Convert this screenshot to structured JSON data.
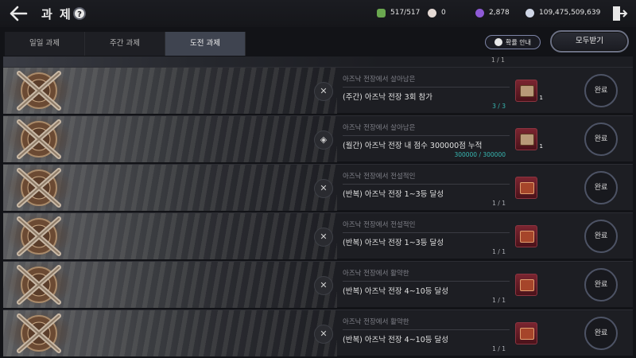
{
  "header": {
    "title": "과 제",
    "help_label": "?",
    "currencies": [
      {
        "icon": "energy-icon",
        "value": "517/517",
        "color": "#6aa84f"
      },
      {
        "icon": "pearl-icon",
        "value": "0",
        "color": "#e4d9d4"
      },
      {
        "icon": "purple-gem-icon",
        "value": "2,878",
        "color": "#8e5ad6"
      },
      {
        "icon": "silver-coin-icon",
        "value": "109,475,509,639",
        "color": "#cfd6e6"
      }
    ]
  },
  "tabs": [
    {
      "label": "일일 과제",
      "active": false
    },
    {
      "label": "주간 과제",
      "active": false
    },
    {
      "label": "도전 과제",
      "active": true
    }
  ],
  "actions": {
    "prob_label": "확률 안내",
    "claim_all_label": "모두받기"
  },
  "partial_row": {
    "progress": "1 / 1"
  },
  "missions": [
    {
      "icon": "cross-icon",
      "icon_glyph": "✕",
      "subtitle": "아즈낙 전장에서 살아남은",
      "title": "(주간) 아즈낙 전장 3회 참가",
      "progress": "3 / 3",
      "progress_teal": true,
      "reward_qty": "1",
      "reward_type": "chest",
      "button": "완료"
    },
    {
      "icon": "diamond-icon",
      "icon_glyph": "◈",
      "subtitle": "아즈낙 전장에서 살아남은",
      "title": "(월간) 아즈낙 전장 내 점수 300000점 누적",
      "progress": "300000 / 300000",
      "progress_teal": true,
      "reward_qty": "1",
      "reward_type": "chest",
      "button": "완료"
    },
    {
      "icon": "cross-icon",
      "icon_glyph": "✕",
      "subtitle": "아즈낙 전장에서 전설적인",
      "title": "(반복) 아즈낙 전장 1~3등 달성",
      "progress": "1 / 1",
      "progress_teal": false,
      "reward_qty": "",
      "reward_type": "red-box",
      "button": "완료"
    },
    {
      "icon": "cross-icon",
      "icon_glyph": "✕",
      "subtitle": "아즈낙 전장에서 전설적인",
      "title": "(반복) 아즈낙 전장 1~3등 달성",
      "progress": "1 / 1",
      "progress_teal": false,
      "reward_qty": "",
      "reward_type": "red-box",
      "button": "완료"
    },
    {
      "icon": "cross-icon",
      "icon_glyph": "✕",
      "subtitle": "아즈낙 전장에서 활약한",
      "title": "(반복) 아즈낙 전장 4~10등 달성",
      "progress": "1 / 1",
      "progress_teal": false,
      "reward_qty": "",
      "reward_type": "red-box",
      "button": "완료"
    },
    {
      "icon": "cross-icon",
      "icon_glyph": "✕",
      "subtitle": "아즈낙 전장에서 활약한",
      "title": "(반복) 아즈낙 전장 4~10등 달성",
      "progress": "1 / 1",
      "progress_teal": false,
      "reward_qty": "",
      "reward_type": "red-box",
      "button": "완료"
    }
  ]
}
